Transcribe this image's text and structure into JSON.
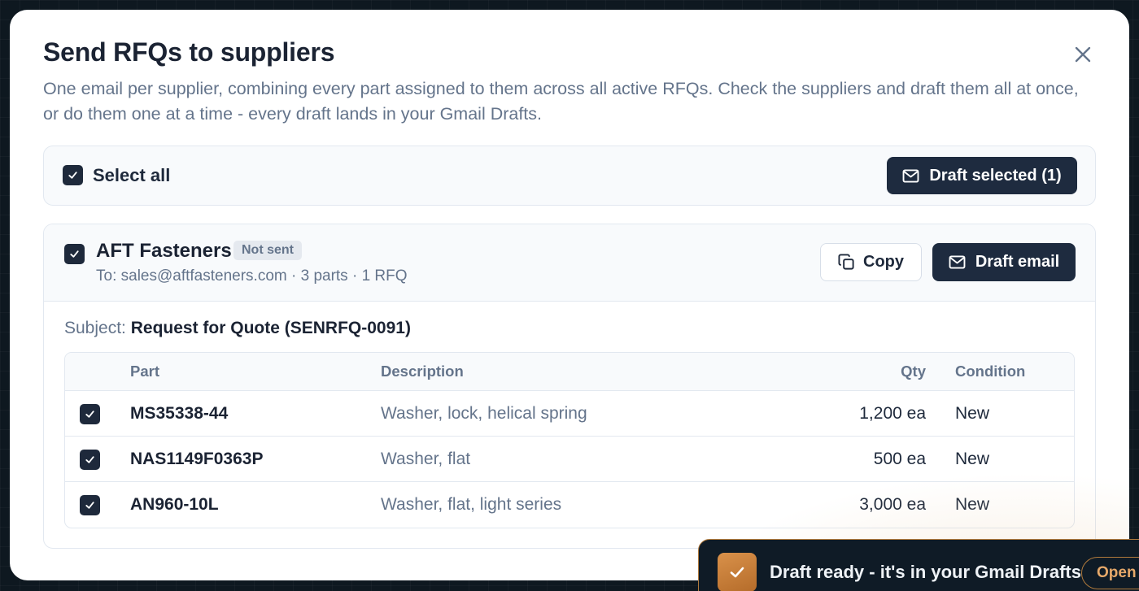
{
  "modal": {
    "title": "Send RFQs to suppliers",
    "description": "One email per supplier, combining every part assigned to them across all active RFQs. Check the suppliers and draft them all at once, or do them one at a time - every draft lands in your Gmail Drafts."
  },
  "select_bar": {
    "select_all_label": "Select all",
    "select_all_checked": true,
    "draft_selected_label": "Draft selected (1)"
  },
  "supplier": {
    "name": "AFT Fasteners",
    "status": "Not sent",
    "meta": "To: sales@aftfasteners.com · 3 parts · 1 RFQ",
    "copy_label": "Copy",
    "draft_email_label": "Draft email",
    "subject_label": "Subject:",
    "subject_value": "Request for Quote (SENRFQ-0091)"
  },
  "table": {
    "headers": {
      "part": "Part",
      "description": "Description",
      "qty": "Qty",
      "condition": "Condition"
    },
    "rows": [
      {
        "part": "MS35338-44",
        "description": "Washer, lock, helical spring",
        "qty": "1,200 ea",
        "condition": "New",
        "checked": true
      },
      {
        "part": "NAS1149F0363P",
        "description": "Washer, flat",
        "qty": "500 ea",
        "condition": "New",
        "checked": true
      },
      {
        "part": "AN960-10L",
        "description": "Washer, flat, light series",
        "qty": "3,000 ea",
        "condition": "New",
        "checked": true
      }
    ]
  },
  "toast": {
    "message": "Draft ready - it's in your Gmail Drafts",
    "action_label": "Open"
  },
  "colors": {
    "primary_dark": "#1e2b3f",
    "toast_accent": "#b07a3c",
    "muted_text": "#64748b"
  }
}
